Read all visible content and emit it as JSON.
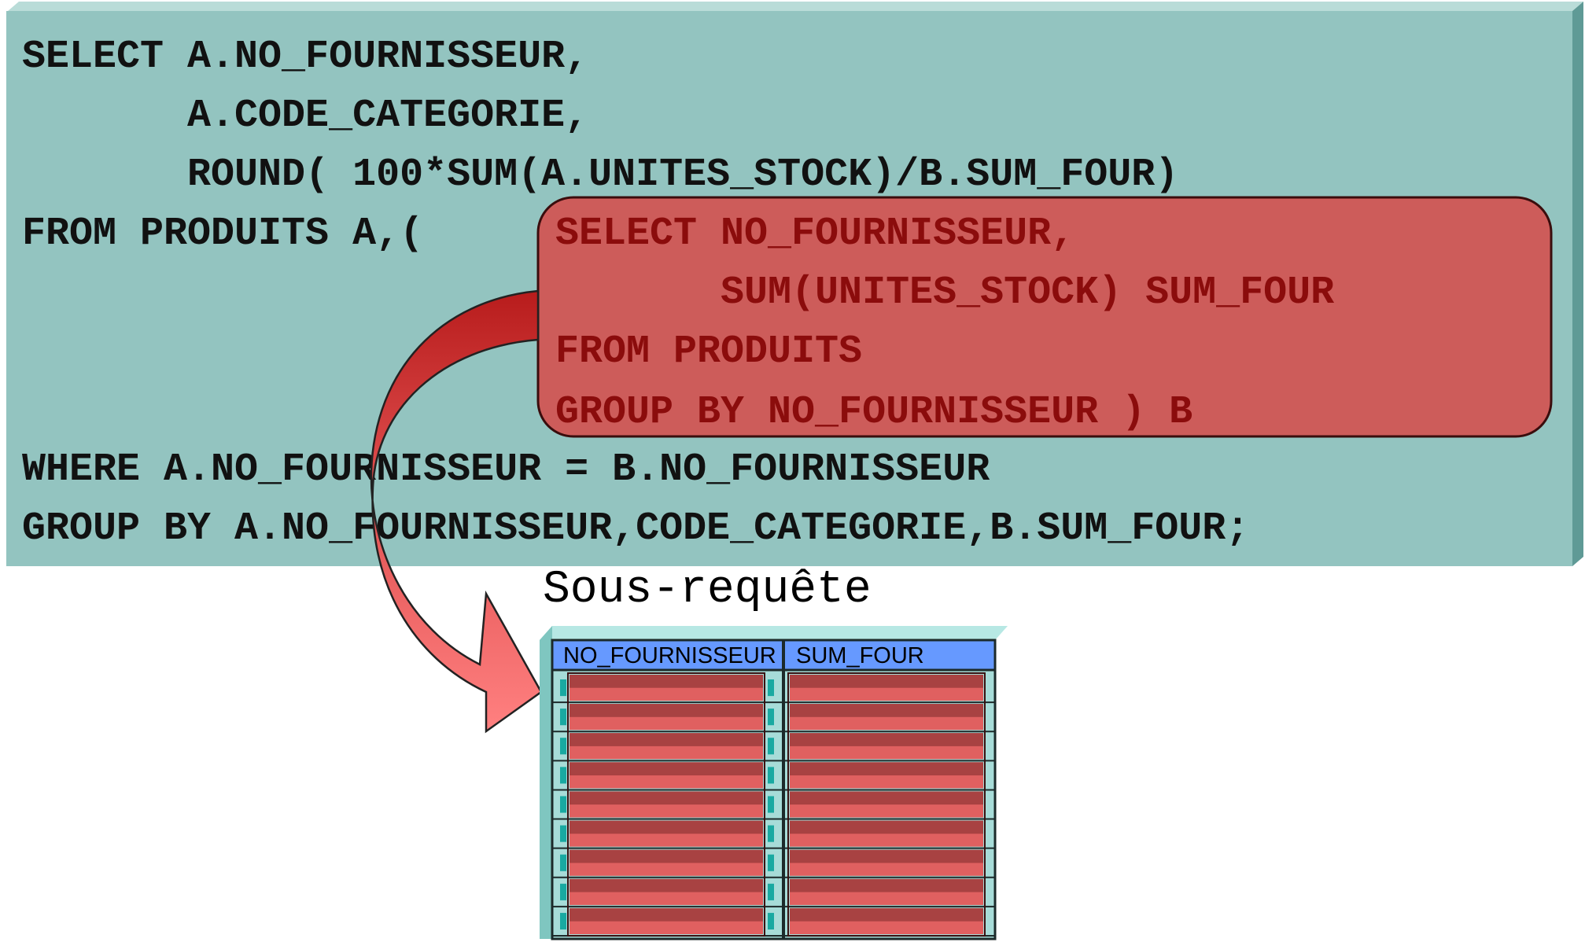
{
  "main_query": {
    "lines": [
      "SELECT A.NO_FOURNISSEUR,",
      "       A.CODE_CATEGORIE,",
      "       ROUND( 100*SUM(A.UNITES_STOCK)/B.SUM_FOUR)",
      "FROM PRODUITS A,(",
      "WHERE A.NO_FOURNISSEUR = B.NO_FOURNISSEUR",
      "GROUP BY A.NO_FOURNISSEUR,CODE_CATEGORIE,B.SUM_FOUR;"
    ],
    "background_color": "#93c4c0"
  },
  "subquery": {
    "lines": [
      "SELECT NO_FOURNISSEUR,",
      "       SUM(UNITES_STOCK) SUM_FOUR",
      "FROM PRODUITS",
      "GROUP BY NO_FOURNISSEUR ) B"
    ],
    "background_color": "#cd5c5a",
    "text_color": "#8b0c0c"
  },
  "caption": "Sous-requête",
  "result_table": {
    "columns": [
      "NO_FOURNISSEUR",
      "SUM_FOUR"
    ],
    "header_color": "#6699ff",
    "row_count": 9
  },
  "arrow": {
    "color": "#ff7777"
  }
}
